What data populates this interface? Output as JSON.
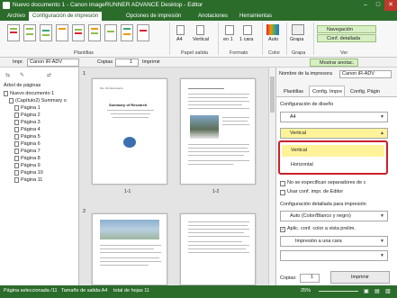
{
  "window": {
    "title": "Nuevo documento 1 - Canon imageRUNNER ADVANCE Desktop - Editor",
    "controls": [
      "–",
      "□",
      "✕"
    ]
  },
  "tabs": [
    "Archivo",
    "Configuración de impresión",
    "Opciones de impresión",
    "Anotaciones",
    "Herramientas"
  ],
  "ribbon": {
    "group_plantillas": "Plantillas",
    "group_papel": "Papel salida",
    "group_formato": "Formato",
    "group_color": "Color",
    "group_grapa": "Grapa",
    "group_ver": "Ver",
    "paper_size": "A4",
    "orientation": "Vertical",
    "pages_per_sheet": "en 1",
    "sides": "1 cara",
    "color_mode": "Auto",
    "staple": "Grapa",
    "nav_button": "Navegación",
    "detail_button": "Conf. detallada",
    "show_annotations": "Mostrar anotac."
  },
  "toolbar": {
    "printer_label": "Impr.",
    "printer_value": "Canon iR-ADV",
    "copies_label": "Copias",
    "copies_value": "1",
    "print_button": "Imprimir"
  },
  "tree": {
    "header": "Árbol de páginas",
    "doc": "Nuevo documento 1",
    "chapter": "(Capítulo2) Summary o",
    "pages": [
      "Página 1",
      "Página 2",
      "Página 3",
      "Página 4",
      "Página 5",
      "Página 6",
      "Página 7",
      "Página 8",
      "Página 9",
      "Página 10",
      "Página 11"
    ]
  },
  "center": {
    "group1": "1",
    "group2": "2",
    "caption1": "1-1",
    "caption2": "1-2",
    "page1_heading": "Summary of Research",
    "page1_sub": "Per. 01 Documento"
  },
  "right": {
    "printer_name_label": "Nombre de la impresora",
    "printer_name_value": "Canon iR-ADV",
    "tabs": [
      "Plantillas",
      "Config. Impre",
      "Config. Págin"
    ],
    "layout_title": "Configuración de diseño",
    "paper_value": "A4",
    "orientation_value": "Vertical",
    "options": [
      "Vertical",
      "Horizontal"
    ],
    "no_separator": "No se especifican separadores de c",
    "use_editor_setting": "Usar conf. impr. de Editor",
    "detail_title": "Configuración detallada para impresión",
    "color_value": "Auto (Color/Blanco y negro)",
    "apply_color": "Aplic. conf. color a vista prelim.",
    "one_side": "Impresión a una cara",
    "copies_label": "Copias:",
    "copies_value": "1",
    "print_button": "Imprimir"
  },
  "status": {
    "selected": "Página seleccionada /11",
    "size": "Tamaño de salida:A4",
    "total": "total de hojas 11",
    "zoom": "25%"
  },
  "colors": {
    "brand_green": "#2b6c2b",
    "highlight_yellow": "#fff39a",
    "callout_red": "#cc1f2a"
  }
}
